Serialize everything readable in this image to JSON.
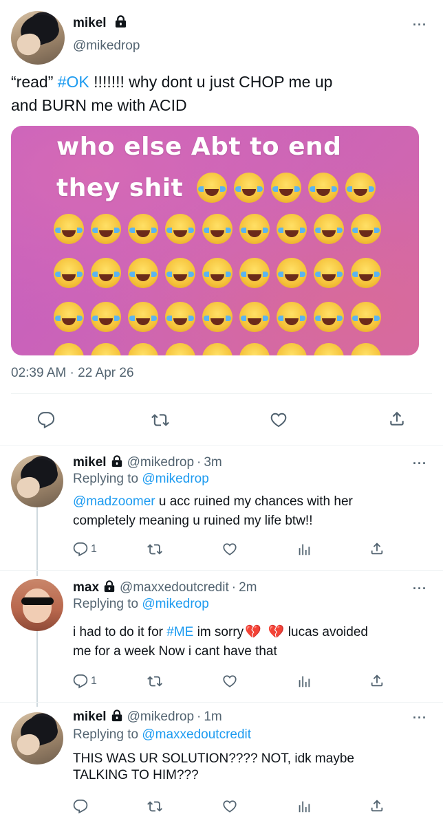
{
  "main_tweet": {
    "display_name": "mikel",
    "handle": "@mikedrop",
    "text_prefix": "“read” ",
    "text_hashtag": "#OK",
    "text_line1_rest": " !!!!!!! why dont u just CHOP me up",
    "text_line2": "and BURN me with ACID",
    "image_text_line1": "who else Abt to end",
    "image_text_line2": "they shit",
    "timestamp": "02:39 AM · 22 Apr 26"
  },
  "replies": [
    {
      "display_name": "mikel",
      "handle": "@mikedrop",
      "time": "3m",
      "replying_label": "Replying to",
      "replying_to": "@mikedrop",
      "mention": "@madzoomer",
      "text_line1_rest": " u acc ruined my chances with her",
      "text_line2": "completely meaning u ruined my life btw!!",
      "reply_count": "1"
    },
    {
      "display_name": "max",
      "handle": "@maxxedoutcredit",
      "time": "2m",
      "replying_label": "Replying to",
      "replying_to": "@mikedrop",
      "text_line1_a": "i had to do it for ",
      "hashtag": "#ME",
      "text_line1_b": " im sorry",
      "text_line1_c": "  lucas avoided",
      "text_line2": "me for a week Now i cant have that",
      "reply_count": "1"
    },
    {
      "display_name": "mikel",
      "handle": "@mikedrop",
      "time": "1m",
      "replying_label": "Replying to",
      "replying_to": "@maxxedoutcredit",
      "text_line1": " THIS WAS UR SOLUTION???? NOT, idk maybe",
      "text_line2": "TALKING TO HIM???"
    }
  ],
  "icons": {
    "more": "more-icon",
    "reply": "reply-icon",
    "retweet": "retweet-icon",
    "like": "heart-icon",
    "share": "share-icon",
    "analytics": "analytics-icon",
    "lock": "lock-icon"
  },
  "colors": {
    "accent": "#1d9bf0",
    "secondary_text": "#536471",
    "divider": "#eff3f4",
    "image_gradient_start": "#c35ec4",
    "image_gradient_end": "#d56aa8"
  }
}
